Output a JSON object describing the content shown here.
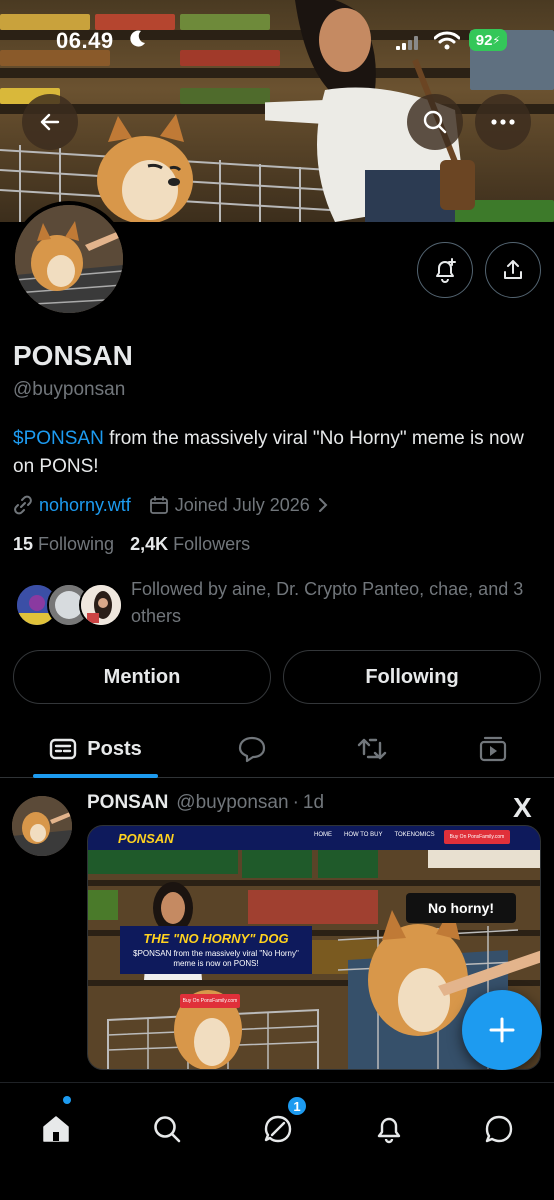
{
  "status_bar": {
    "time": "06.49",
    "battery": "92"
  },
  "profile": {
    "display_name": "PONSAN",
    "handle": "@buyponsan",
    "bio_cashtag": "$PONSAN",
    "bio_rest": " from the massively viral \"No Horny\" meme is now on PONS!",
    "website": "nohorny.wtf",
    "joined": "Joined July 2026",
    "following_count": "15",
    "following_label": "Following",
    "followers_count": "2,4K",
    "followers_label": "Followers",
    "followed_by": "Followed by aine, Dr. Crypto Panteo, chae, and 3 others"
  },
  "actions": {
    "mention_label": "Mention",
    "following_label": "Following"
  },
  "tabs": {
    "posts_label": "Posts"
  },
  "post": {
    "name": "PONSAN",
    "handle": "@buyponsan",
    "time": "1d",
    "x_logo": "X",
    "media": {
      "brand": "PONSAN",
      "nav_links": [
        "HOME",
        "HOW TO BUY",
        "TOKENOMICS"
      ],
      "nav_buy": "Buy On PonsFamily.com",
      "headline": "THE \"NO HORNY\" DOG",
      "subhead": "$PONSAN from the massively viral \"No Horny\" meme is now on PONS!",
      "buy_button": "Buy On PonsFamily.com",
      "bubble": "No horny!"
    }
  },
  "bottom_nav": {
    "messages_badge": "1"
  },
  "colors": {
    "accent": "#1d9bf0",
    "text": "#e7e9ea",
    "muted": "#71767b",
    "background": "#000000",
    "battery": "#34c759"
  }
}
